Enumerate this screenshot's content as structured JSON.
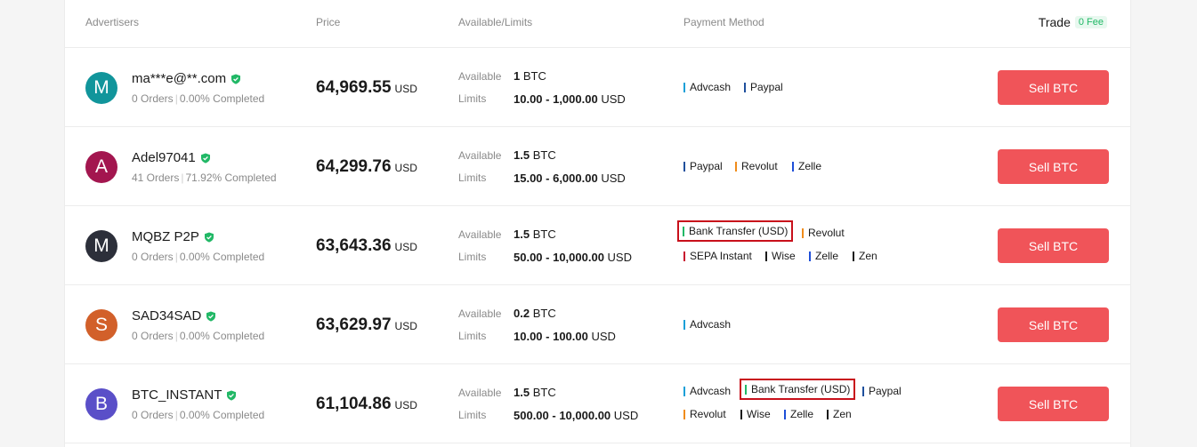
{
  "header": {
    "advertisers": "Advertisers",
    "price": "Price",
    "available_limits": "Available/Limits",
    "payment_method": "Payment Method",
    "trade": "Trade",
    "fee_badge": "0 Fee"
  },
  "labels": {
    "available": "Available",
    "limits": "Limits"
  },
  "colors": {
    "sell_button": "#f05459",
    "highlight": "#c8101b",
    "verified": "#21b866"
  },
  "rows": [
    {
      "avatar_letter": "M",
      "avatar_color": "#11959b",
      "name": "ma***e@**.com",
      "orders": "0 Orders",
      "completion": "0.00% Completed",
      "price": "64,969.55",
      "price_unit": "USD",
      "available_amount": "1",
      "available_unit": "BTC",
      "limits_range": "10.00 - 1,000.00",
      "limits_unit": "USD",
      "payments": [
        {
          "name": "Advcash",
          "color": "#1a9fd8"
        },
        {
          "name": "Paypal",
          "color": "#1e4f9c"
        }
      ],
      "action": "Sell BTC"
    },
    {
      "avatar_letter": "A",
      "avatar_color": "#a3164f",
      "name": "Adel97041",
      "orders": "41 Orders",
      "completion": "71.92% Completed",
      "price": "64,299.76",
      "price_unit": "USD",
      "available_amount": "1.5",
      "available_unit": "BTC",
      "limits_range": "15.00 - 6,000.00",
      "limits_unit": "USD",
      "payments": [
        {
          "name": "Paypal",
          "color": "#1e4f9c"
        },
        {
          "name": "Revolut",
          "color": "#f08c1a"
        },
        {
          "name": "Zelle",
          "color": "#1e4fd8"
        }
      ],
      "action": "Sell BTC"
    },
    {
      "avatar_letter": "M",
      "avatar_color": "#2c2f3a",
      "name": "MQBZ P2P",
      "orders": "0 Orders",
      "completion": "0.00% Completed",
      "price": "63,643.36",
      "price_unit": "USD",
      "available_amount": "1.5",
      "available_unit": "BTC",
      "limits_range": "50.00 - 10,000.00",
      "limits_unit": "USD",
      "payments": [
        {
          "name": "Bank Transfer (USD)",
          "color": "#21b866",
          "highlighted": true
        },
        {
          "name": "Revolut",
          "color": "#f08c1a"
        },
        {
          "name": "SEPA Instant",
          "color": "#c8102e"
        },
        {
          "name": "Wise",
          "color": "#1a1a1a"
        },
        {
          "name": "Zelle",
          "color": "#1e4fd8"
        },
        {
          "name": "Zen",
          "color": "#1a1a1a"
        }
      ],
      "action": "Sell BTC"
    },
    {
      "avatar_letter": "S",
      "avatar_color": "#d2602a",
      "name": "SAD34SAD",
      "orders": "0 Orders",
      "completion": "0.00% Completed",
      "price": "63,629.97",
      "price_unit": "USD",
      "available_amount": "0.2",
      "available_unit": "BTC",
      "limits_range": "10.00 - 100.00",
      "limits_unit": "USD",
      "payments": [
        {
          "name": "Advcash",
          "color": "#1a9fd8"
        }
      ],
      "action": "Sell BTC"
    },
    {
      "avatar_letter": "B",
      "avatar_color": "#5a4fc8",
      "name": "BTC_INSTANT",
      "orders": "0 Orders",
      "completion": "0.00% Completed",
      "price": "61,104.86",
      "price_unit": "USD",
      "available_amount": "1.5",
      "available_unit": "BTC",
      "limits_range": "500.00 - 10,000.00",
      "limits_unit": "USD",
      "payments": [
        {
          "name": "Advcash",
          "color": "#1a9fd8"
        },
        {
          "name": "Bank Transfer (USD)",
          "color": "#21b866",
          "highlighted": true
        },
        {
          "name": "Paypal",
          "color": "#1e4f9c"
        },
        {
          "name": "Revolut",
          "color": "#f08c1a"
        },
        {
          "name": "Wise",
          "color": "#1a1a1a"
        },
        {
          "name": "Zelle",
          "color": "#1e4fd8"
        },
        {
          "name": "Zen",
          "color": "#1a1a1a"
        }
      ],
      "action": "Sell BTC"
    }
  ]
}
